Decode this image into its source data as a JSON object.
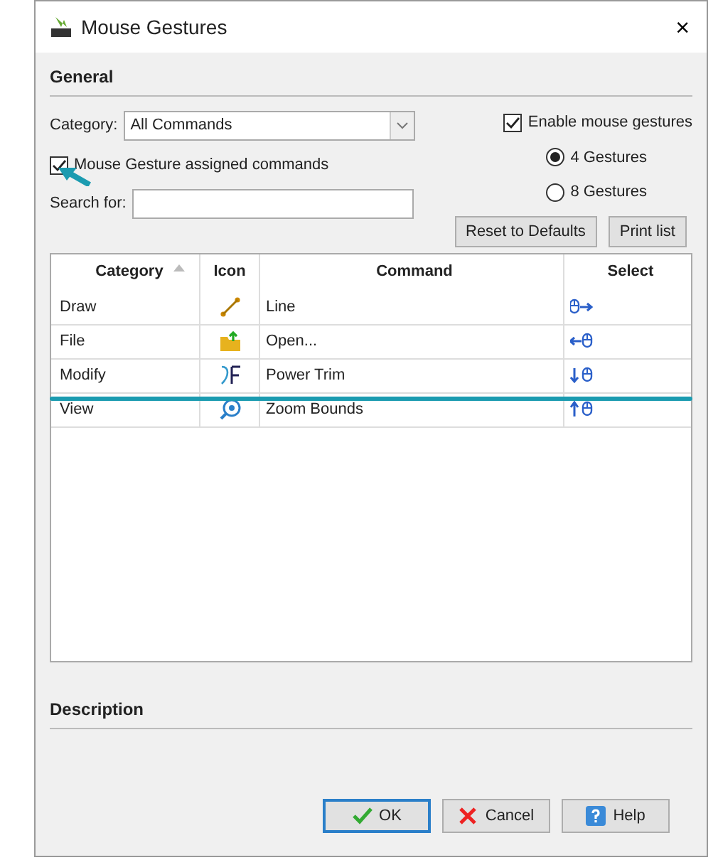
{
  "window": {
    "title": "Mouse Gestures",
    "close_glyph": "×"
  },
  "general": {
    "heading": "General",
    "category_label": "Category:",
    "category_value": "All Commands",
    "assigned_only": {
      "label": "Mouse Gesture assigned commands",
      "checked": true
    },
    "search_label": "Search for:",
    "enable": {
      "label": "Enable mouse gestures",
      "checked": true
    },
    "gesture_modes": [
      {
        "label": "4 Gestures",
        "selected": true
      },
      {
        "label": "8 Gestures",
        "selected": false
      }
    ],
    "buttons": [
      "Reset to Defaults",
      "Print list"
    ]
  },
  "table": {
    "columns": [
      "Category",
      "Icon",
      "Command",
      "Select"
    ],
    "rows": [
      {
        "category": "Draw",
        "kind": "line",
        "command": "Line"
      },
      {
        "category": "File",
        "kind": "folder",
        "command": "Open..."
      },
      {
        "category": "Modify",
        "kind": "trim",
        "command": "Power Trim"
      },
      {
        "category": "View",
        "kind": "zoom",
        "command": "Zoom Bounds"
      }
    ]
  },
  "description": {
    "heading": "Description"
  },
  "footer_buttons": [
    {
      "kind": "ok",
      "label": "OK"
    },
    {
      "kind": "cancel",
      "label": "Cancel"
    },
    {
      "kind": "help",
      "label": "Help"
    }
  ]
}
